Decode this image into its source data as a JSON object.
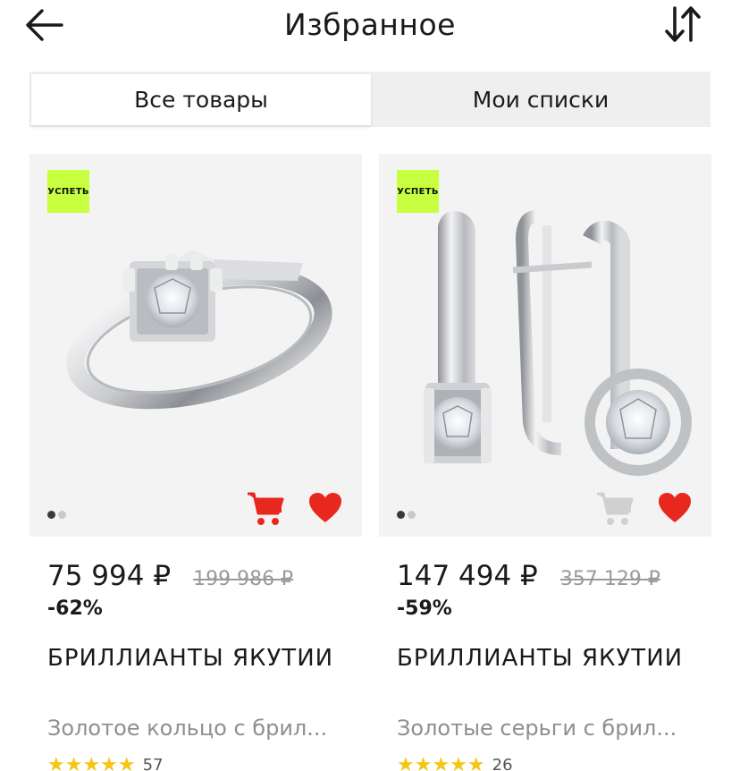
{
  "header": {
    "title": "Избранное"
  },
  "tabs": [
    {
      "label": "Все товары",
      "active": true
    },
    {
      "label": "Мои списки",
      "active": false
    }
  ],
  "products": [
    {
      "badge": "УСПЕТЬ",
      "image": "ring-icon",
      "price": "75 994 ₽",
      "old_price": "199 986 ₽",
      "discount": "-62%",
      "brand": "БРИЛЛИАНТЫ ЯКУТИИ",
      "description": "Золотое кольцо с брил...",
      "stars": "★★★★★",
      "reviews": "57",
      "in_cart": true,
      "favorite": true
    },
    {
      "badge": "УСПЕТЬ",
      "image": "earrings-icon",
      "price": "147 494 ₽",
      "old_price": "357 129 ₽",
      "discount": "-59%",
      "brand": "БРИЛЛИАНТЫ ЯКУТИИ",
      "description": "Золотые серьги с брил...",
      "stars": "★★★★★",
      "reviews": "26",
      "in_cart": false,
      "favorite": true
    }
  ],
  "colors": {
    "badge": "#c8ff3e",
    "accent_red": "#e8281e",
    "cart_inactive": "#d0d0d0",
    "star": "#f5c518"
  }
}
